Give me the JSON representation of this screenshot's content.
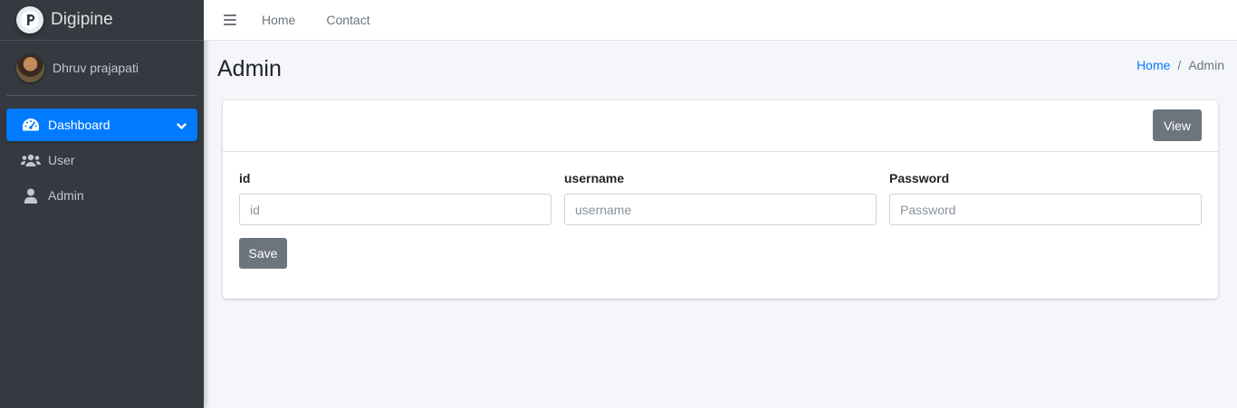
{
  "brand": {
    "name": "Digipine",
    "logo_icon": "digipine-logo-icon"
  },
  "user": {
    "name": "Dhruv prajapati"
  },
  "sidebar": {
    "items": [
      {
        "label": "Dashboard",
        "icon": "tachometer-icon",
        "active": true
      },
      {
        "label": "User",
        "icon": "users-icon",
        "active": false
      },
      {
        "label": "Admin",
        "icon": "user-icon",
        "active": false
      }
    ]
  },
  "navbar": {
    "links": [
      "Home",
      "Contact"
    ]
  },
  "header": {
    "title": "Admin"
  },
  "breadcrumb": {
    "home": "Home",
    "separator": "/",
    "current": "Admin"
  },
  "card": {
    "view_label": "View",
    "fields": [
      {
        "label": "id",
        "placeholder": "id",
        "value": ""
      },
      {
        "label": "username",
        "placeholder": "username",
        "value": ""
      },
      {
        "label": "Password",
        "placeholder": "Password",
        "value": ""
      }
    ],
    "save_label": "Save"
  },
  "colors": {
    "sidebar_bg": "#343a40",
    "accent": "#007bff",
    "button_secondary": "#6c757d",
    "content_bg": "#f4f6f9"
  }
}
